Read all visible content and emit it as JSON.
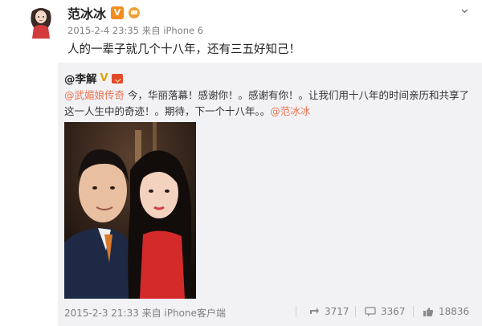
{
  "post": {
    "author": "范冰冰",
    "meta": "2015-2-4 23:35 来自 iPhone 6",
    "text": "人的一辈子就几个十八年，还有三五好知己！",
    "close_label": "⌄"
  },
  "repost": {
    "author": "@李解",
    "mention_1": "@武媚娘传奇",
    "text_1": " 今，华丽落幕！感谢你！。感谢有你！。让我们用十八年的时间亲历和共享了这一人生中的奇迹！。期待，下一个十八年。。",
    "mention_2": "@范冰冰",
    "meta": "2015-2-3 21:33 来自 iPhone客户端",
    "repost_count": "3717",
    "comment_count": "3367",
    "like_count": "18836"
  },
  "icons": {
    "verified": "vip-badge-icon",
    "crown": "crown-icon",
    "repost": "repost-icon",
    "comment": "comment-icon",
    "like": "like-icon"
  },
  "colors": {
    "mention": "#eb7350",
    "repost_bg": "#f2f2f5",
    "meta": "#808080"
  }
}
